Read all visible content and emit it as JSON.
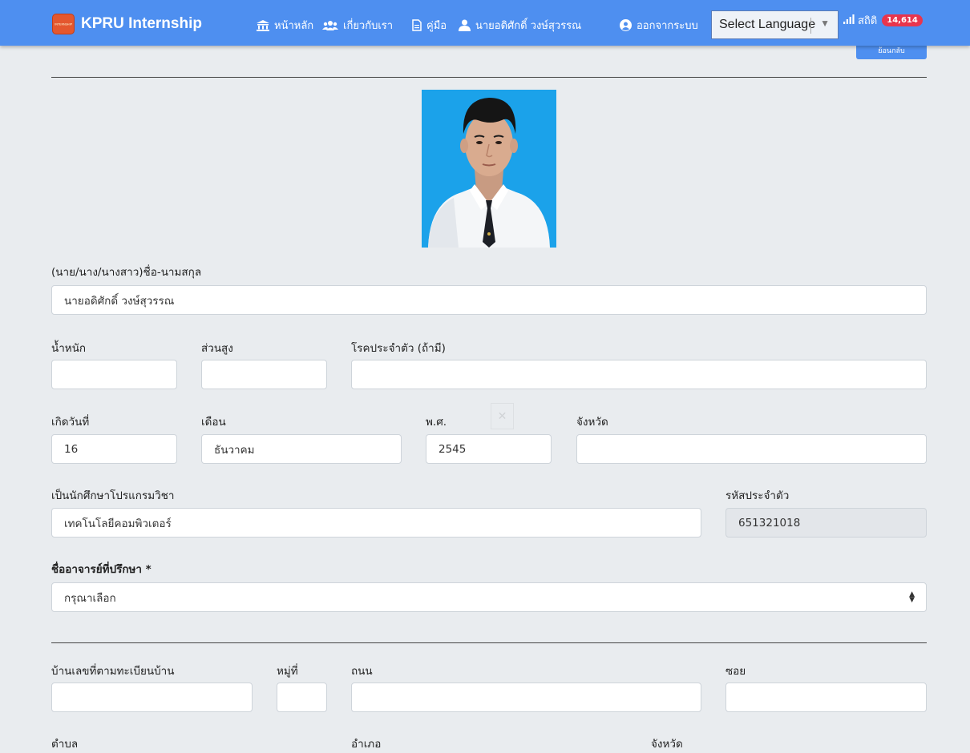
{
  "navbar": {
    "brand": "KPRU Internship",
    "logo_text": "INTERNSHIP",
    "items": [
      {
        "label": "หน้าหลัก",
        "icon": "bank-icon"
      },
      {
        "label": "เกี่ยวกับเรา",
        "icon": "users-icon"
      },
      {
        "label": "คู่มือ",
        "icon": "document-icon"
      },
      {
        "label": "นายอดิศักดิ์ วงษ์สุวรรณ",
        "icon": "user-icon"
      },
      {
        "label": "ออกจากระบบ",
        "icon": "user-circle-icon"
      }
    ],
    "language_select": "Select Language",
    "stats_label": "สถิติ",
    "stats_count": "14,614",
    "back_button": "ย้อนกลับ"
  },
  "form": {
    "name_label": "(นาย/นาง/นางสาว)ชื่อ-นามสกุล",
    "name_value": "นายอดิศักดิ์ วงษ์สุวรรณ",
    "weight_label": "น้ำหนัก",
    "weight_value": "",
    "height_label": "ส่วนสูง",
    "height_value": "",
    "disease_label": "โรคประจำตัว (ถ้ามี)",
    "disease_value": "",
    "birth_day_label": "เกิดวันที่",
    "birth_day_value": "16",
    "birth_month_label": "เดือน",
    "birth_month_value": "ธันวาคม",
    "birth_year_label": "พ.ศ.",
    "birth_year_value": "2545",
    "birth_province_label": "จังหวัด",
    "birth_province_value": "",
    "program_label": "เป็นนักศึกษาโปรแกรมวิชา",
    "program_value": "เทคโนโลยีคอมพิวเตอร์",
    "student_id_label": "รหัสประจำตัว",
    "student_id_value": "651321018",
    "advisor_label": "ชื่ออาจารย์ที่ปรึกษา *",
    "advisor_value": "กรุณาเลือก",
    "house_no_label": "บ้านเลขที่ตามทะเบียนบ้าน",
    "house_no_value": "",
    "moo_label": "หมู่ที่",
    "moo_value": "",
    "road_label": "ถนน",
    "road_value": "",
    "soi_label": "ซอย",
    "soi_value": "",
    "subdistrict_label": "ตำบล",
    "district_label": "อำเภอ",
    "province_label": "จังหวัด"
  },
  "colors": {
    "navbar": "#4e8ff0",
    "page_background": "#e9ecef",
    "badge": "#e8354d"
  }
}
